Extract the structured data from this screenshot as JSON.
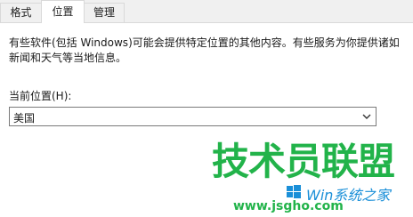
{
  "tabs": [
    {
      "label": "格式",
      "active": false
    },
    {
      "label": "位置",
      "active": true
    },
    {
      "label": "管理",
      "active": false
    }
  ],
  "location_page": {
    "description": "有些软件(包括 Windows)可能会提供特定位置的其他内容。有些服务为你提供诸如新闻和天气等当地信息。",
    "current_location_label": "当前位置(H):",
    "current_location_value": "美国",
    "dropdown_icon": "chevron-down-icon"
  },
  "watermark": {
    "logo_text": "技术员联盟",
    "sub_text": "Win系统之家",
    "url": "www.jsgho.com",
    "logo_color": "#22b34a",
    "sub_color": "#1a8fd8"
  }
}
